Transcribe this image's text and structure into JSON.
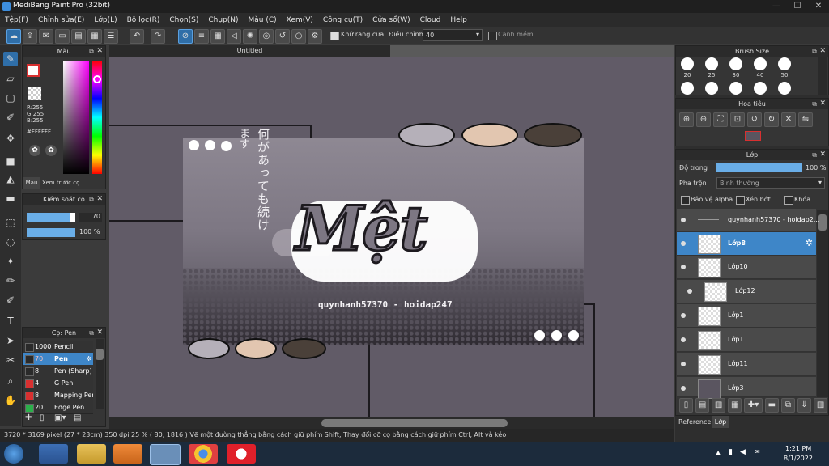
{
  "window": {
    "title": "MediBang Paint Pro (32bit)",
    "min": "—",
    "max": "☐",
    "close": "✕"
  },
  "menu": [
    "Tệp(F)",
    "Chỉnh sửa(E)",
    "Lớp(L)",
    "Bộ lọc(R)",
    "Chọn(S)",
    "Chụp(N)",
    "Màu (C)",
    "Xem(V)",
    "Công cụ(T)",
    "Cửa sổ(W)",
    "Cloud",
    "Help"
  ],
  "toolbar": {
    "antialias_label": "Khử răng cưa",
    "adjust_label": "Điều chỉnh",
    "adjust_value": "40",
    "edge_label": "Cạnh mềm"
  },
  "color_panel": {
    "title": "Màu",
    "r": "R:255",
    "g": "G:255",
    "b": "B:255",
    "hex": "#FFFFFF",
    "tab1": "Màu",
    "tab2": "Xem trước cọ"
  },
  "brush_control": {
    "title": "Kiểm soát cọ",
    "size": "70",
    "opacity": "100 %"
  },
  "brush_list": {
    "title": "Cọ: Pen",
    "items": [
      {
        "size": "1000",
        "name": "Pencil",
        "color": "#2a2a2a"
      },
      {
        "size": "70",
        "name": "Pen",
        "color": "#2a2a2a"
      },
      {
        "size": "8",
        "name": "Pen (Sharp)",
        "color": "#2a2a2a"
      },
      {
        "size": "4",
        "name": "G Pen",
        "color": "#d83030"
      },
      {
        "size": "8",
        "name": "Mapping Pen",
        "color": "#d83030"
      },
      {
        "size": "20",
        "name": "Edge Pen",
        "color": "#2bb04a"
      }
    ]
  },
  "canvas": {
    "tab": "Untitled",
    "title_text": "Mệt",
    "credit": "quynhanh57370 - hoidap247",
    "jp_text1": "何があっても続け",
    "jp_text2": "ます",
    "palette_top": [
      "#b5b0b9",
      "#e2c6b0",
      "#4a4039"
    ],
    "palette_bottom": [
      "#b5b0b9",
      "#e2c6b0",
      "#4a4039"
    ]
  },
  "status": {
    "text": "3720 * 3169 pixel   (27 * 23cm)   350 dpi   25 %   ( 80, 1816 )   Vẽ một đường thẳng bằng cách giữ phím Shift, Thay đổi cỡ cọ bằng cách giữ phím Ctrl, Alt và kéo"
  },
  "brush_size_panel": {
    "title": "Brush Size",
    "sizes": [
      "20",
      "25",
      "30",
      "40",
      "50"
    ]
  },
  "navigator": {
    "title": "Hoa tiêu"
  },
  "layer_panel": {
    "title": "Lớp",
    "opacity_label": "Độ trong",
    "opacity_value": "100 %",
    "blend_label": "Pha trộn",
    "blend_value": "Bình thường",
    "protect_alpha": "Bảo vệ alpha",
    "clipping": "Xén bớt",
    "lock": "Khóa",
    "layers": [
      "quynhanh57370 - hoidap2...",
      "Lớp8",
      "Lớp10",
      "Lớp12",
      "Lớp1",
      "Lớp1",
      "Lớp11",
      "Lớp3"
    ],
    "tab_reference": "Reference",
    "tab_layer": "Lớp"
  },
  "taskbar": {
    "time": "1:21 PM",
    "date": "8/1/2022"
  }
}
